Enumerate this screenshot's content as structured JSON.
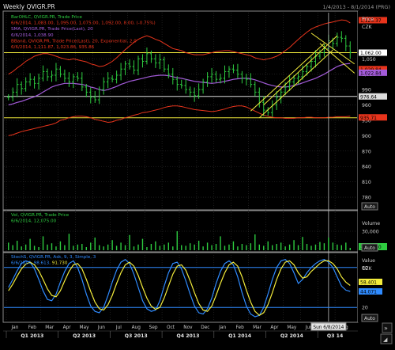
{
  "window": {
    "title": "Weekly QVIGR.PR",
    "date_range": "1/4/2013 - 8/1/2014 (PRG)"
  },
  "colors": {
    "price": "#2ecc40",
    "sma": "#a35bd9",
    "bband": "#e8341c",
    "hline": "#f3ec3c",
    "hline_white": "#d8d8d8",
    "volume": "#2ecc40",
    "stoch_k": "#2f8bff",
    "stoch_d": "#f3ec3c",
    "stoch_level": "#2f8bff",
    "grid": "#3a3a3a",
    "axis_text": "#cccccc",
    "panel_border": "#8a8a8a"
  },
  "price_panel": {
    "legend": [
      {
        "text": "BarOHLC, QVIGR.PR, Trade Price",
        "color": "#2ecc40"
      },
      {
        "text": "6/6/2014, 1,083.00, 1,095.00, 1,075.00, 1,092.00,",
        "color": "#e8341c",
        "extra": "8.00, (-0.75%)"
      },
      {
        "text": "SMA, QVIGR.PR, Trade Price(Last), 20",
        "color": "#a35bd9"
      },
      {
        "text": "6/6/2014, 1,038.90",
        "color": "#a35bd9"
      },
      {
        "text": "BBand, QVIGR.PR, Trade Price(Last), 20, Exponential, 2.0",
        "color": "#e8341c"
      },
      {
        "text": "6/6/2014, 1,111.87, 1,023.86, 935.86",
        "color": "#e8341c"
      }
    ],
    "axis_title": "Price",
    "currency": "CZK",
    "y_ticks": [
      {
        "label": "1,050",
        "value": 1050
      },
      {
        "label": "1,020",
        "value": 1020
      },
      {
        "label": "990",
        "value": 990
      },
      {
        "label": "960",
        "value": 960
      },
      {
        "label": "930",
        "value": 930
      },
      {
        "label": "900",
        "value": 900
      },
      {
        "label": "870",
        "value": 870
      },
      {
        "label": "840",
        "value": 840
      },
      {
        "label": "810",
        "value": 810
      },
      {
        "label": "780",
        "value": 780
      }
    ],
    "badges": [
      {
        "label": "1,125.37",
        "value": 1125.37,
        "bg": "#e8341c",
        "fg": "#000000"
      },
      {
        "label": "1,062.00",
        "value": 1062,
        "bg": "#ffffff",
        "fg": "#000000"
      },
      {
        "label": "1,029.84",
        "value": 1029.84,
        "bg": "#e8341c",
        "fg": "#000000"
      },
      {
        "label": "1,022.84",
        "value": 1022.84,
        "bg": "#a35bd9",
        "fg": "#000000"
      },
      {
        "label": "976.64",
        "value": 976.64,
        "bg": "#dddddd",
        "fg": "#000000"
      },
      {
        "label": "935.71",
        "value": 935.71,
        "bg": "#e8341c",
        "fg": "#000000"
      }
    ],
    "auto_label": "Auto"
  },
  "volume_panel": {
    "legend": [
      {
        "text": "Vol, QVIGR.PR, Trade Price",
        "color": "#2ecc40"
      },
      {
        "text": "6/6/2014, 12,075.00",
        "color": "#2ecc40"
      }
    ],
    "axis_title": "Volume",
    "y_ticks": [
      {
        "label": "30,000",
        "value": 30000
      }
    ],
    "badge": {
      "label": "3,726.00",
      "bg": "#2ecc40",
      "fg": "#000000"
    },
    "auto_label": "Auto"
  },
  "stoch_panel": {
    "legend": [
      {
        "text": "StochS, QVIGR.PR, Ask, 9, 3, Simple, 3",
        "color": "#2f8bff"
      },
      {
        "text": "6/6/2014, 98.613,",
        "color": "#2f8bff",
        "extra": "91.730",
        "extra_color": "#f3ec3c"
      }
    ],
    "axis_title": "Value",
    "currency": "CZK",
    "y_ticks": [
      {
        "label": "80",
        "value": 80
      },
      {
        "label": "20",
        "value": 20
      }
    ],
    "badges": [
      {
        "label": "58.401",
        "value": 58.401,
        "bg": "#f3ec3c",
        "fg": "#000000"
      },
      {
        "label": "44.071",
        "value": 44.071,
        "bg": "#2f8bff",
        "fg": "#000000"
      }
    ],
    "auto_label": "Auto"
  },
  "time_axis": {
    "months": [
      "Jan",
      "Feb",
      "Mar",
      "Apr",
      "May",
      "Jun",
      "Jul",
      "Aug",
      "Sep",
      "Oct",
      "Nov",
      "Dec",
      "Jan",
      "Feb",
      "Mar",
      "Apr",
      "May",
      "Jun",
      "Jul",
      "Aug"
    ],
    "quarters": [
      "Q1 2013",
      "Q2 2013",
      "Q3 2013",
      "Q4 2013",
      "Q1 2014",
      "Q2 2014",
      "Q3 14"
    ],
    "cursor_label": "Sun 6/8/2014"
  },
  "chart_data": [
    {
      "type": "bar",
      "title": "BarOHLC, QVIGR.PR, Trade Price",
      "subtype": "ohlc",
      "ylim": [
        760,
        1140
      ],
      "x_start": "2013-01-04",
      "x_end": "2014-08-01",
      "series": [
        {
          "name": "BarOHLC Close",
          "values": [
            975,
            985,
            1000,
            992,
            1005,
            1010,
            1002,
            1012,
            1025,
            1015,
            1018,
            1030,
            1020,
            1012,
            1005,
            1015,
            1012,
            995,
            985,
            975,
            970,
            990,
            1005,
            1012,
            1010,
            1018,
            1030,
            1040,
            1035,
            1028,
            1050,
            1045,
            1060,
            1050,
            1042,
            1048,
            1030,
            1020,
            1010,
            1000,
            998,
            990,
            985,
            978,
            990,
            1005,
            1015,
            1020,
            1010,
            1012,
            1025,
            1030,
            1028,
            1020,
            1012,
            1010,
            1000,
            985,
            965,
            950,
            945,
            960,
            975,
            985,
            995,
            1005,
            1012,
            1015,
            1025,
            1035,
            1045,
            1055,
            1062,
            1070,
            1085,
            1080,
            1092,
            1090,
            1075,
            1062
          ]
        },
        {
          "name": "SMA 20",
          "values": [
            960,
            962,
            965,
            967,
            970,
            973,
            976,
            980,
            985,
            990,
            995,
            998,
            1000,
            1002,
            1002,
            1002,
            1001,
            1000,
            998,
            995,
            993,
            990,
            988,
            990,
            993,
            996,
            1000,
            1003,
            1006,
            1008,
            1010,
            1012,
            1014,
            1016,
            1017,
            1018,
            1018,
            1017,
            1015,
            1013,
            1012,
            1010,
            1008,
            1006,
            1005,
            1004,
            1003,
            1002,
            1003,
            1004,
            1006,
            1008,
            1010,
            1011,
            1012,
            1012,
            1011,
            1009,
            1006,
            1003,
            1000,
            998,
            996,
            995,
            995,
            996,
            998,
            1000,
            1003,
            1006,
            1009,
            1012,
            1016,
            1020,
            1025,
            1030,
            1035,
            1038,
            1040,
            1041
          ]
        },
        {
          "name": "BBand Upper",
          "values": [
            1020,
            1025,
            1032,
            1038,
            1045,
            1050,
            1055,
            1058,
            1060,
            1060,
            1058,
            1055,
            1052,
            1050,
            1048,
            1050,
            1048,
            1046,
            1044,
            1040,
            1038,
            1035,
            1036,
            1040,
            1045,
            1052,
            1060,
            1068,
            1075,
            1082,
            1088,
            1092,
            1095,
            1092,
            1088,
            1085,
            1080,
            1075,
            1070,
            1068,
            1066,
            1062,
            1060,
            1058,
            1058,
            1058,
            1060,
            1062,
            1064,
            1065,
            1066,
            1066,
            1064,
            1062,
            1060,
            1058,
            1056,
            1052,
            1050,
            1048,
            1050,
            1052,
            1055,
            1060,
            1066,
            1072,
            1080,
            1088,
            1095,
            1102,
            1108,
            1112,
            1115,
            1118,
            1120,
            1122,
            1124,
            1126,
            1125,
            1120
          ]
        },
        {
          "name": "BBand Lower",
          "values": [
            900,
            902,
            905,
            908,
            910,
            912,
            914,
            916,
            918,
            920,
            922,
            925,
            930,
            932,
            935,
            937,
            938,
            938,
            937,
            935,
            932,
            930,
            928,
            926,
            927,
            930,
            932,
            935,
            937,
            940,
            942,
            945,
            946,
            948,
            950,
            952,
            955,
            957,
            958,
            958,
            957,
            955,
            953,
            951,
            950,
            949,
            948,
            947,
            948,
            950,
            952,
            955,
            957,
            958,
            958,
            956,
            952,
            948,
            944,
            940,
            938,
            936,
            935,
            935,
            934,
            934,
            934,
            935,
            935,
            936,
            936,
            935,
            935,
            935,
            936,
            936,
            937,
            937,
            937,
            938
          ]
        }
      ],
      "hlines": [
        {
          "value": 1062,
          "color": "yellow"
        },
        {
          "value": 976.64,
          "color": "white"
        },
        {
          "value": 935,
          "color": "yellow"
        }
      ],
      "annotations": [
        "ascending channel (yellow)",
        "descending channel (yellow)"
      ]
    },
    {
      "type": "bar",
      "title": "Vol, QVIGR.PR, Trade Price",
      "ylim": [
        0,
        60000
      ],
      "series": [
        {
          "name": "Volume",
          "values": [
            12000,
            8000,
            15000,
            6000,
            9000,
            18000,
            7000,
            5000,
            22000,
            9000,
            11000,
            6000,
            14000,
            8000,
            26000,
            7000,
            9000,
            10000,
            5000,
            12000,
            20000,
            8000,
            6000,
            9000,
            16000,
            7000,
            12000,
            8000,
            24000,
            6000,
            9000,
            18000,
            5000,
            10000,
            14000,
            7000,
            9000,
            12000,
            6000,
            30000,
            8000,
            7000,
            11000,
            9000,
            15000,
            6000,
            12000,
            8000,
            10000,
            22000,
            7000,
            9000,
            14000,
            6000,
            10000,
            8000,
            11000,
            25000,
            9000,
            7000,
            14000,
            8000,
            10000,
            12000,
            6000,
            9000,
            16000,
            8000,
            21000,
            10000,
            7000,
            9000,
            13000,
            11000,
            20000,
            12075,
            9000,
            8000,
            12000,
            3726
          ]
        }
      ],
      "yticks": [
        "30,000"
      ]
    },
    {
      "type": "line",
      "title": "StochS, QVIGR.PR, Ask, 9, 3, Simple, 3",
      "ylim": [
        0,
        100
      ],
      "series": [
        {
          "name": "StochS %K",
          "values": [
            50,
            62,
            75,
            86,
            90,
            88,
            78,
            62,
            45,
            32,
            30,
            40,
            58,
            74,
            86,
            90,
            80,
            62,
            40,
            22,
            14,
            12,
            20,
            38,
            58,
            76,
            88,
            92,
            86,
            70,
            50,
            30,
            18,
            14,
            16,
            30,
            52,
            72,
            86,
            88,
            78,
            60,
            40,
            22,
            12,
            10,
            18,
            34,
            56,
            74,
            86,
            90,
            84,
            66,
            42,
            22,
            10,
            6,
            8,
            20,
            40,
            62,
            80,
            90,
            92,
            86,
            72,
            56,
            62,
            72,
            80,
            86,
            90,
            92,
            88,
            80,
            66,
            52,
            46,
            44
          ]
        },
        {
          "name": "StochS %D",
          "values": [
            45,
            55,
            67,
            78,
            85,
            88,
            84,
            75,
            62,
            48,
            38,
            36,
            45,
            60,
            74,
            84,
            86,
            78,
            62,
            44,
            28,
            18,
            16,
            24,
            38,
            56,
            72,
            84,
            88,
            82,
            68,
            50,
            34,
            22,
            17,
            20,
            34,
            52,
            70,
            82,
            84,
            76,
            60,
            42,
            26,
            16,
            14,
            22,
            38,
            56,
            72,
            84,
            88,
            82,
            66,
            46,
            28,
            14,
            8,
            12,
            24,
            42,
            62,
            78,
            88,
            90,
            84,
            72,
            64,
            66,
            74,
            80,
            86,
            90,
            90,
            86,
            78,
            66,
            58,
            53
          ]
        }
      ],
      "levels": [
        80,
        20
      ]
    }
  ]
}
